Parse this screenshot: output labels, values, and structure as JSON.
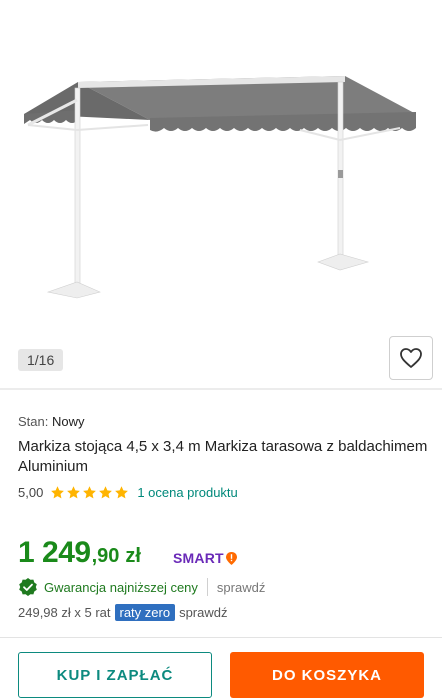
{
  "gallery": {
    "counter": "1/16",
    "image_icon": "awning-product-image",
    "favorite_icon": "heart-icon"
  },
  "product": {
    "condition_label": "Stan:",
    "condition_value": "Nowy",
    "title": "Markiza stojąca 4,5 x 3,4 m Markiza tarasowa z baldachimem Aluminium",
    "rating_value": "5,00",
    "rating_stars": 5,
    "rating_link": "1 ocena produktu"
  },
  "price": {
    "main": "1 249",
    "cents": ",90",
    "currency": "zł",
    "smart_label": "SMART",
    "color": "#1a8a1a"
  },
  "guarantee": {
    "text": "Gwarancja najniższej ceny",
    "check_link": "sprawdź"
  },
  "installment": {
    "amount_text": "249,98 zł x 5 rat",
    "badge": "raty zero",
    "check_link": "sprawdź"
  },
  "actions": {
    "buy_now": "KUP I ZAPŁAĆ",
    "add_to_cart": "DO KOSZYKA",
    "accent_teal": "#0c8a7f",
    "accent_orange": "#ff5a00"
  }
}
